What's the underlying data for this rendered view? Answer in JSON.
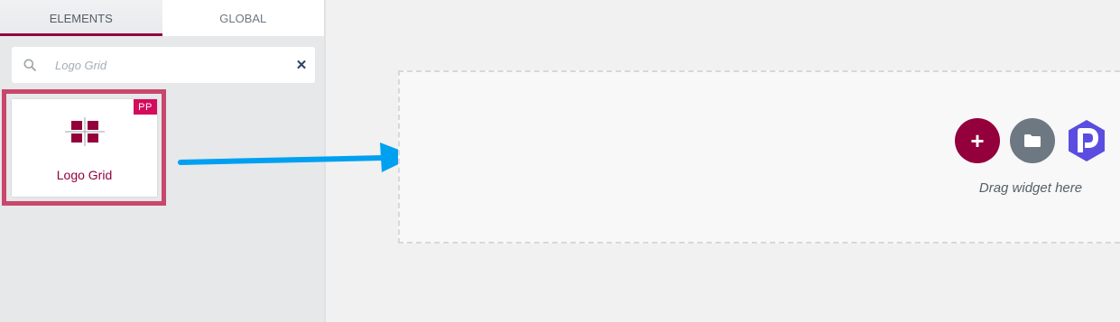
{
  "tabs": [
    {
      "label": "ELEMENTS",
      "active": true
    },
    {
      "label": "GLOBAL",
      "active": false
    }
  ],
  "search": {
    "value": "Logo Grid",
    "icon": "search-icon",
    "clear_icon": "close-icon",
    "clear_glyph": "✕"
  },
  "widget": {
    "label": "Logo Grid",
    "badge": "PP",
    "icon": "logo-grid-icon"
  },
  "drop_area": {
    "add_glyph": "+",
    "folder_icon": "folder-icon",
    "pp_icon": "powerpack-logo-icon",
    "drag_text": "Drag widget here"
  },
  "colors": {
    "accent": "#93003c",
    "badge": "#d30c5c",
    "highlight": "#c9476b",
    "arrow": "#00a0f0",
    "folder_button": "#6d7882",
    "pp_logo": "#5b4de0"
  }
}
